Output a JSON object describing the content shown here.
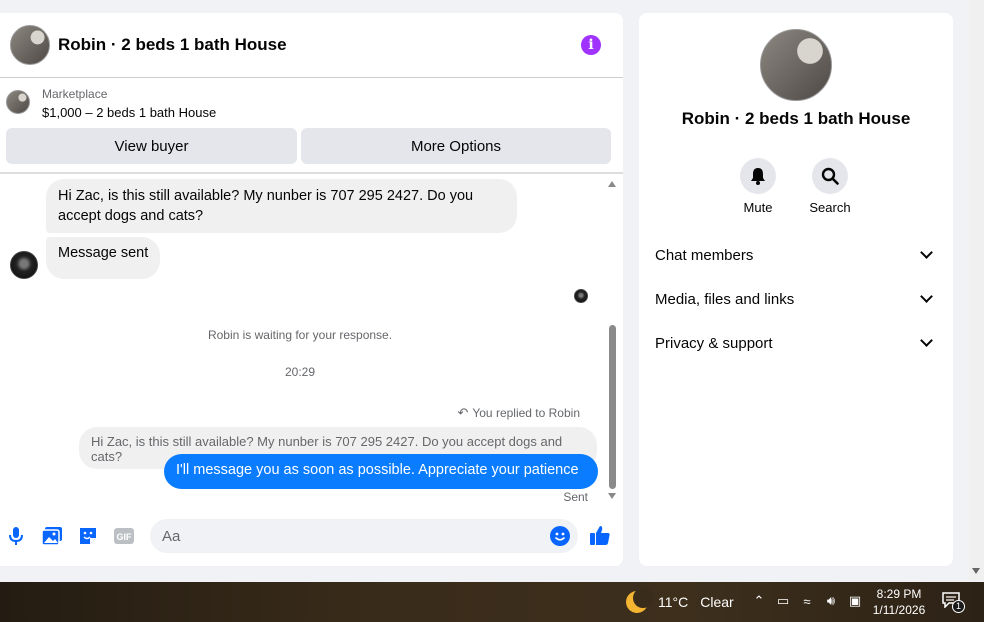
{
  "header": {
    "title": "Robin · 2 beds 1 bath House",
    "info_icon": "info-icon"
  },
  "marketplace": {
    "label": "Marketplace",
    "item": "$1,000 – 2 beds 1 bath House"
  },
  "buttons": {
    "view_buyer": "View buyer",
    "more_options": "More Options"
  },
  "messages": {
    "incoming_1": "Hi Zac, is this still available? My nunber is 707 295 2427. Do you accept dogs and cats?",
    "incoming_2": "Message sent",
    "waiting": "Robin is waiting for your response.",
    "time": "20:29",
    "replied_to": "You replied to Robin",
    "quoted": "Hi Zac, is this still available? My nunber is 707 295 2427. Do you accept dogs and cats?",
    "outgoing": "I'll message you as soon as possible. Appreciate your patience",
    "status": "Sent"
  },
  "composer": {
    "placeholder": "Aa",
    "accent": "#0866ff"
  },
  "right_panel": {
    "title": "Robin · 2 beds 1 bath House",
    "actions": [
      {
        "label": "Mute",
        "icon": "bell-icon"
      },
      {
        "label": "Search",
        "icon": "search-icon"
      }
    ],
    "sections": [
      {
        "label": "Chat members"
      },
      {
        "label": "Media, files and links"
      },
      {
        "label": "Privacy & support"
      }
    ]
  },
  "taskbar": {
    "temperature": "11°C",
    "condition": "Clear",
    "time": "8:29 PM",
    "date": "1/11/2026",
    "notification_count": "1"
  }
}
